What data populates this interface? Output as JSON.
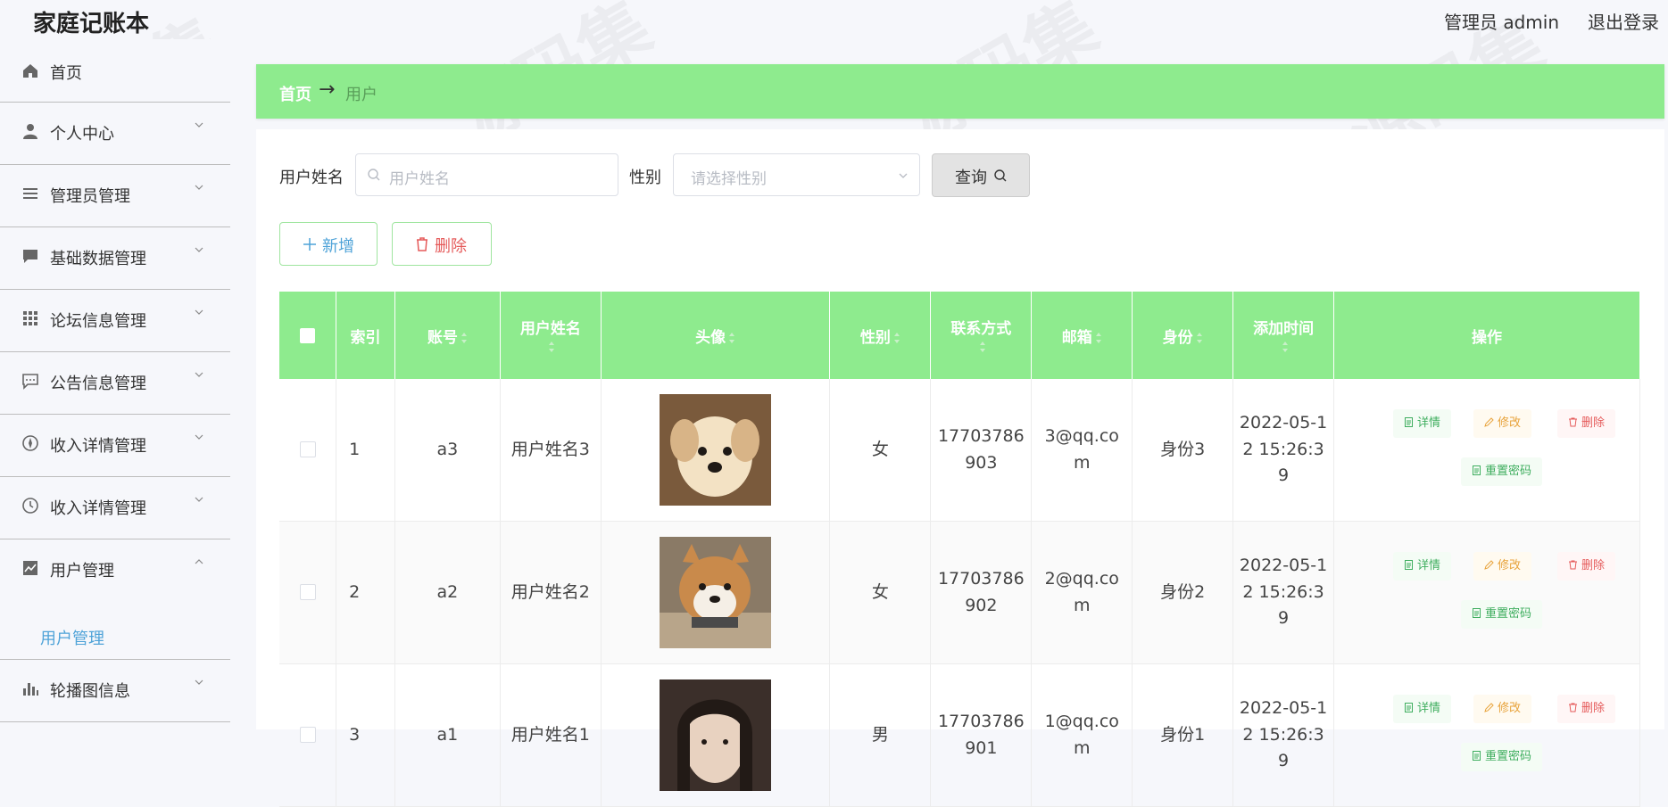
{
  "app": {
    "title": "家庭记账本"
  },
  "header": {
    "admin_label": "管理员 admin",
    "logout_label": "退出登录"
  },
  "sidebar": {
    "items": [
      {
        "label": "首页",
        "icon": "home-icon"
      },
      {
        "label": "个人中心",
        "icon": "user-icon"
      },
      {
        "label": "管理员管理",
        "icon": "list-icon"
      },
      {
        "label": "基础数据管理",
        "icon": "chat-icon"
      },
      {
        "label": "论坛信息管理",
        "icon": "grid-icon"
      },
      {
        "label": "公告信息管理",
        "icon": "message-icon"
      },
      {
        "label": "收入详情管理",
        "icon": "compass-icon"
      },
      {
        "label": "收入详情管理",
        "icon": "clock-icon"
      },
      {
        "label": "用户管理",
        "icon": "chart-icon",
        "expanded": true,
        "submenu": [
          "用户管理"
        ]
      },
      {
        "label": "轮播图信息",
        "icon": "bar-chart-icon"
      }
    ]
  },
  "breadcrumb": {
    "home": "首页",
    "current": "用户"
  },
  "search": {
    "name_label": "用户姓名",
    "name_placeholder": "用户姓名",
    "gender_label": "性别",
    "gender_placeholder": "请选择性别",
    "query_label": "查询"
  },
  "actions": {
    "add_label": "新增",
    "delete_label": "删除"
  },
  "table": {
    "columns": [
      "索引",
      "账号",
      "用户姓名",
      "头像",
      "性别",
      "联系方式",
      "邮箱",
      "身份",
      "添加时间",
      "操作"
    ],
    "rows": [
      {
        "index": "1",
        "account": "a3",
        "name": "用户姓名3",
        "gender": "女",
        "phone": "17703786903",
        "email": "3@qq.com",
        "role": "身份3",
        "time": "2022-05-12 15:26:39"
      },
      {
        "index": "2",
        "account": "a2",
        "name": "用户姓名2",
        "gender": "女",
        "phone": "17703786902",
        "email": "2@qq.com",
        "role": "身份2",
        "time": "2022-05-12 15:26:39"
      },
      {
        "index": "3",
        "account": "a1",
        "name": "用户姓名1",
        "gender": "男",
        "phone": "17703786901",
        "email": "1@qq.com",
        "role": "身份1",
        "time": "2022-05-12 15:26:39"
      }
    ],
    "ops": {
      "detail": "详情",
      "edit": "修改",
      "delete": "删除",
      "reset": "重置密码"
    }
  },
  "watermark_text": "源码集",
  "colors": {
    "accent_green": "#8eeb8e",
    "link_blue": "#4fa3d8",
    "danger_red": "#e55a5a",
    "warning_orange": "#e8a33b"
  }
}
